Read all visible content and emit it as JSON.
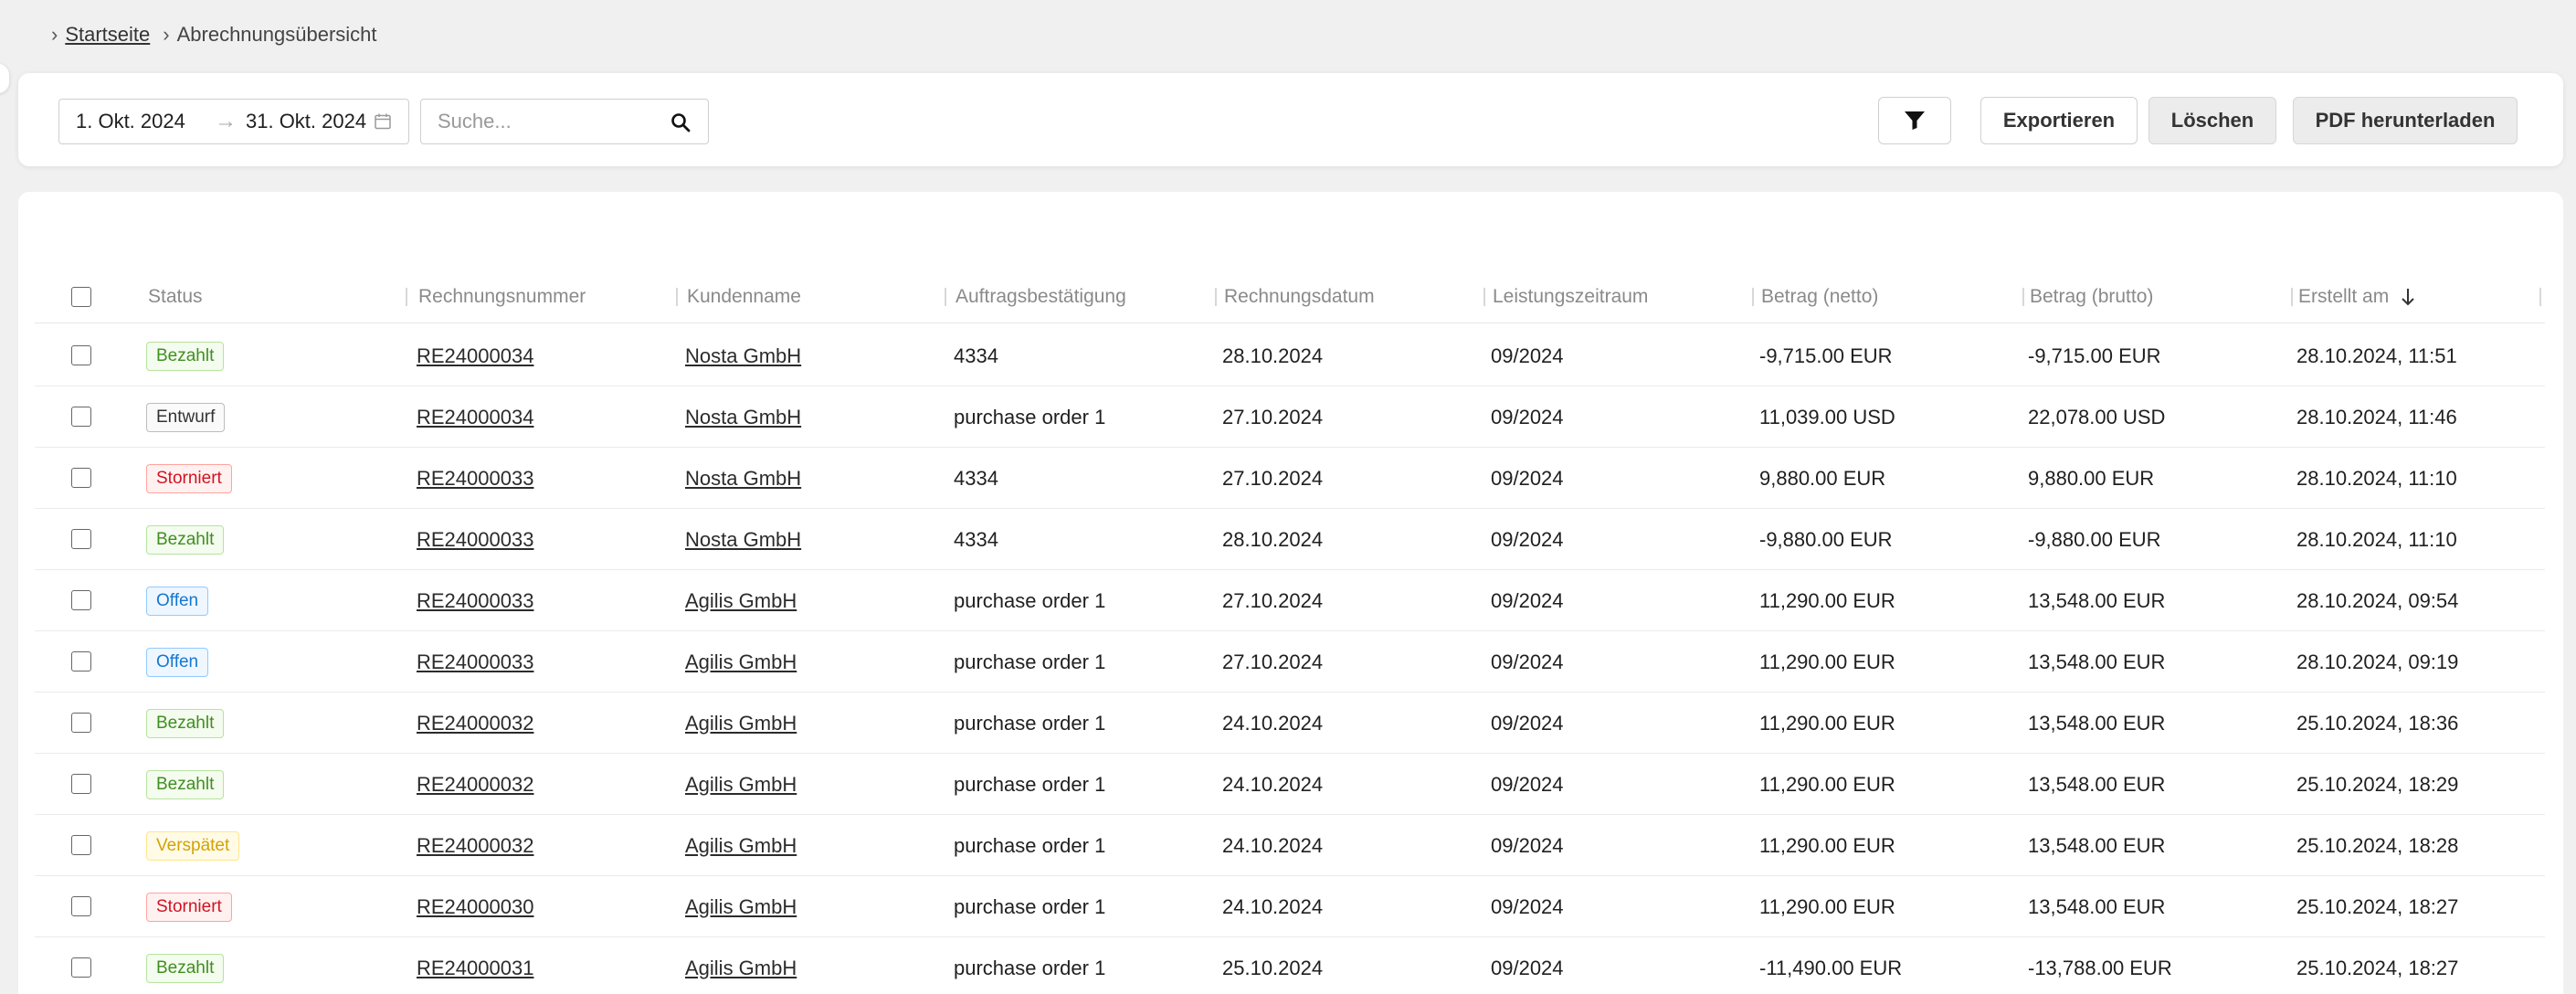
{
  "breadcrumb": {
    "home": "Startseite",
    "current": "Abrechnungsübersicht"
  },
  "toolbar": {
    "date_from": "1. Okt. 2024",
    "date_to": "31. Okt. 2024",
    "search_placeholder": "Suche...",
    "export_label": "Exportieren",
    "delete_label": "Löschen",
    "pdf_label": "PDF herunterladen"
  },
  "table": {
    "columns": [
      "Status",
      "Rechnungsnummer",
      "Kundenname",
      "Auftragsbestätigung",
      "Rechnungsdatum",
      "Leistungszeitraum",
      "Betrag (netto)",
      "Betrag (brutto)",
      "Erstellt am"
    ],
    "sorted_column": "Erstellt am",
    "sort_direction": "descending",
    "rows": [
      {
        "status": "Bezahlt",
        "status_color": "#3f8f1f",
        "invoice": "RE24000034",
        "customer": "Nosta GmbH",
        "order": "4334",
        "invoice_date": "28.10.2024",
        "period": "09/2024",
        "net": "-9,715.00 EUR",
        "gross": "-9,715.00 EUR",
        "created": "28.10.2024, 11:51"
      },
      {
        "status": "Entwurf",
        "status_color": "#333333",
        "invoice": "RE24000034",
        "customer": "Nosta GmbH",
        "order": "purchase order 1",
        "invoice_date": "27.10.2024",
        "period": "09/2024",
        "net": "11,039.00 USD",
        "gross": "22,078.00 USD",
        "created": "28.10.2024, 11:46"
      },
      {
        "status": "Storniert",
        "status_color": "#cf1322",
        "invoice": "RE24000033",
        "customer": "Nosta GmbH",
        "order": "4334",
        "invoice_date": "27.10.2024",
        "period": "09/2024",
        "net": "9,880.00 EUR",
        "gross": "9,880.00 EUR",
        "created": "28.10.2024, 11:10"
      },
      {
        "status": "Bezahlt",
        "status_color": "#3f8f1f",
        "invoice": "RE24000033",
        "customer": "Nosta GmbH",
        "order": "4334",
        "invoice_date": "28.10.2024",
        "period": "09/2024",
        "net": "-9,880.00 EUR",
        "gross": "-9,880.00 EUR",
        "created": "28.10.2024, 11:10"
      },
      {
        "status": "Offen",
        "status_color": "#1677cf",
        "invoice": "RE24000033",
        "customer": "Agilis GmbH",
        "order": "purchase order 1",
        "invoice_date": "27.10.2024",
        "period": "09/2024",
        "net": "11,290.00 EUR",
        "gross": "13,548.00 EUR",
        "created": "28.10.2024, 09:54"
      },
      {
        "status": "Offen",
        "status_color": "#1677cf",
        "invoice": "RE24000033",
        "customer": "Agilis GmbH",
        "order": "purchase order 1",
        "invoice_date": "27.10.2024",
        "period": "09/2024",
        "net": "11,290.00 EUR",
        "gross": "13,548.00 EUR",
        "created": "28.10.2024, 09:19"
      },
      {
        "status": "Bezahlt",
        "status_color": "#3f8f1f",
        "invoice": "RE24000032",
        "customer": "Agilis GmbH",
        "order": "purchase order 1",
        "invoice_date": "24.10.2024",
        "period": "09/2024",
        "net": "11,290.00 EUR",
        "gross": "13,548.00 EUR",
        "created": "25.10.2024, 18:36"
      },
      {
        "status": "Bezahlt",
        "status_color": "#3f8f1f",
        "invoice": "RE24000032",
        "customer": "Agilis GmbH",
        "order": "purchase order 1",
        "invoice_date": "24.10.2024",
        "period": "09/2024",
        "net": "11,290.00 EUR",
        "gross": "13,548.00 EUR",
        "created": "25.10.2024, 18:29"
      },
      {
        "status": "Verspätet",
        "status_color": "#d4a106",
        "invoice": "RE24000032",
        "customer": "Agilis GmbH",
        "order": "purchase order 1",
        "invoice_date": "24.10.2024",
        "period": "09/2024",
        "net": "11,290.00 EUR",
        "gross": "13,548.00 EUR",
        "created": "25.10.2024, 18:28"
      },
      {
        "status": "Storniert",
        "status_color": "#cf1322",
        "invoice": "RE24000030",
        "customer": "Agilis GmbH",
        "order": "purchase order 1",
        "invoice_date": "24.10.2024",
        "period": "09/2024",
        "net": "11,290.00 EUR",
        "gross": "13,548.00 EUR",
        "created": "25.10.2024, 18:27"
      },
      {
        "status": "Bezahlt",
        "status_color": "#3f8f1f",
        "invoice": "RE24000031",
        "customer": "Agilis GmbH",
        "order": "purchase order 1",
        "invoice_date": "25.10.2024",
        "period": "09/2024",
        "net": "-11,490.00 EUR",
        "gross": "-13,788.00 EUR",
        "created": "25.10.2024, 18:27"
      }
    ]
  }
}
